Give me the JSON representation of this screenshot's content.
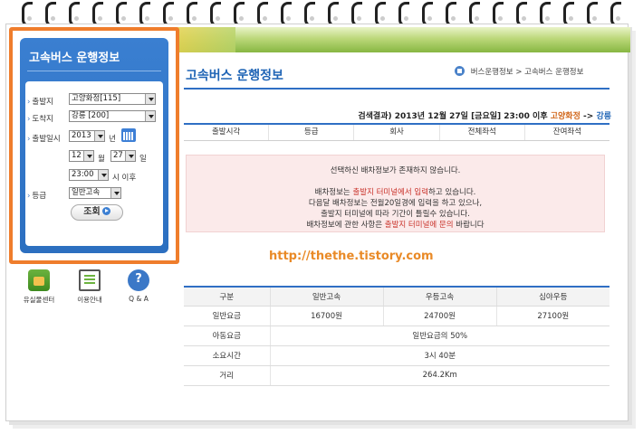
{
  "sidebar": {
    "title": "고속버스 운행정보",
    "departure_label": "출발지",
    "departure_value": "고양화정[115]",
    "arrival_label": "도착지",
    "arrival_value": "강릉 [200]",
    "date_label": "출발일시",
    "year_value": "2013",
    "year_unit": "년",
    "month_value": "12",
    "month_unit": "월",
    "day_value": "27",
    "day_unit": "일",
    "time_value": "23:00",
    "time_unit": "시 이후",
    "grade_label": "등급",
    "grade_value": "일반고속",
    "search_button": "조회"
  },
  "quick_links": [
    {
      "label": "유실물센터",
      "icon": "lost-and-found-icon"
    },
    {
      "label": "이용안내",
      "icon": "guide-icon"
    },
    {
      "label": "Q & A",
      "icon": "qa-icon"
    }
  ],
  "main": {
    "page_title": "고속버스 운행정보",
    "breadcrumb_1": "버스운행정보",
    "breadcrumb_sep": ">",
    "breadcrumb_2": "고속버스 운행정보",
    "result_prefix": "검색결과) 2013년 12월 27일 [금요일] 23:00 이후",
    "result_from": "고양화정",
    "result_arrow": "->",
    "result_to": "강릉",
    "columns": [
      "출발시각",
      "등급",
      "회사",
      "전체좌석",
      "잔여좌석"
    ],
    "notice_main": "선택하신 배차정보가 존재하지 않습니다.",
    "notice_line2_a": "배차정보는",
    "notice_line2_red": "출발지 터미널에서 입력",
    "notice_line2_b": "하고 있습니다.",
    "notice_line3": "다음달 배차정보는 전월20일경에 입력을 하고 있으나,",
    "notice_line4": "출발지 터미널에 따라 기간이 틀릴수 있습니다.",
    "notice_line5_a": "배차정보에 관한 사항은",
    "notice_line5_red": "출발지 터미널에 문의",
    "notice_line5_b": "바랍니다",
    "watermark": "http://thethe.tistory.com"
  },
  "fare_table": {
    "headers": [
      "구분",
      "일반고속",
      "우등고속",
      "심야우등"
    ],
    "row1_label": "일반요금",
    "row1_values": [
      "16700원",
      "24700원",
      "27100원"
    ],
    "row2_label": "아동요금",
    "row2_value": "일반요금의 50%",
    "row3_label": "소요시간",
    "row3_value": "3시 40분",
    "row4_label": "거리",
    "row4_value": "264.2Km"
  },
  "colors": {
    "accent_blue": "#2f6fc4",
    "highlight_orange": "#ef7d2c",
    "notice_bg": "#fbeaea"
  }
}
